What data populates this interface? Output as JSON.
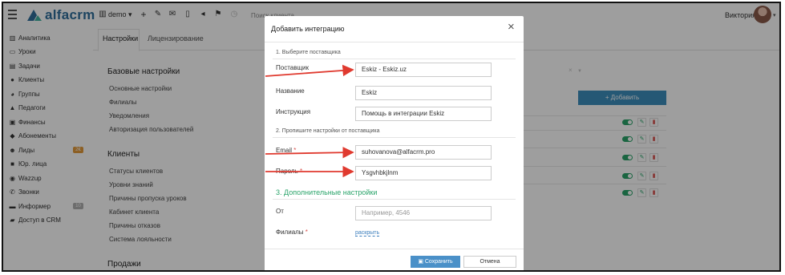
{
  "topbar": {
    "logo_text": "alfacrm",
    "branch_label": "demo",
    "search_placeholder": "Поиск клиента",
    "user_name": "Виктория",
    "icons": [
      "plus-icon",
      "wrench-icon",
      "mail-icon",
      "phone-icon",
      "send-icon",
      "flag-icon",
      "history-icon"
    ]
  },
  "sidebar": {
    "items": [
      {
        "label": "Аналитика",
        "icon": "chart-icon"
      },
      {
        "label": "Уроки",
        "icon": "calendar-icon"
      },
      {
        "label": "Задачи",
        "icon": "tasks-icon"
      },
      {
        "label": "Клиенты",
        "icon": "user-icon"
      },
      {
        "label": "Группы",
        "icon": "users-icon"
      },
      {
        "label": "Педагоги",
        "icon": "graduation-icon"
      },
      {
        "label": "Финансы",
        "icon": "money-icon"
      },
      {
        "label": "Абонементы",
        "icon": "tag-icon"
      },
      {
        "label": "Лиды",
        "icon": "lead-icon",
        "badge": "2€",
        "badge_color": "#e39a3b"
      },
      {
        "label": "Юр. лица",
        "icon": "briefcase-icon"
      },
      {
        "label": "Wazzup",
        "icon": "whatsapp-icon"
      },
      {
        "label": "Звонки",
        "icon": "phone-icon"
      },
      {
        "label": "Информер",
        "icon": "inbox-icon",
        "badge": "10",
        "badge_color": "#b0b0b0"
      },
      {
        "label": "Доступ в CRM",
        "icon": "lock-icon"
      }
    ]
  },
  "main": {
    "tabs": [
      "Настройки",
      "Лицензирование"
    ],
    "sections": [
      {
        "title": "Базовые настройки",
        "links": [
          "Основные настройки",
          "Филиалы",
          "Уведомления",
          "Авторизация пользователей"
        ]
      },
      {
        "title": "Клиенты",
        "links": [
          "Статусы клиентов",
          "Уровни знаний",
          "Причины пропуска уроков",
          "Кабинет клиента",
          "Причины отказов",
          "Система лояльности"
        ]
      },
      {
        "title": "Продажи",
        "links": []
      }
    ],
    "add_button": "+ Добавить"
  },
  "modal": {
    "title": "Добавить интеграцию",
    "step1": "1. Выберите поставщика",
    "provider_label": "Поставщик",
    "provider_value": "Eskiz - Eskiz.uz",
    "name_label": "Название",
    "name_value": "Eskiz",
    "instruction_label": "Инструкция",
    "instruction_value": "Помощь в интеграции Eskiz",
    "step2": "2. Пропишите настройки от поставщика",
    "email_label": "Email",
    "email_value": "suhovanova@alfacrm.pro",
    "password_label": "Пароль",
    "password_value": "Ysgvhbkjlnm",
    "step3": "3. Дополнительные настройки",
    "from_label": "От",
    "from_placeholder": "Например, 4546",
    "branches_label": "Филиалы",
    "reveal_link": "раскрыть",
    "save_button": "Сохранить",
    "cancel_button": "Отмена",
    "required_mark": "*"
  },
  "colors": {
    "accent": "#3d8ebd",
    "success": "#2aa46a",
    "arrow": "#e03a2f"
  }
}
